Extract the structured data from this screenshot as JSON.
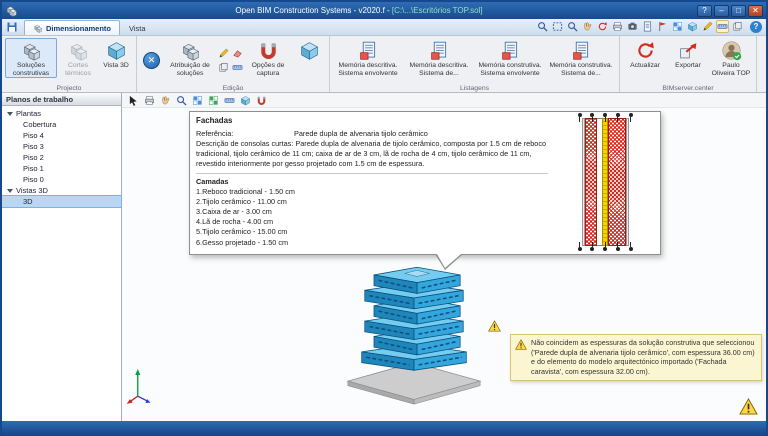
{
  "window": {
    "title_main": "Open BIM Construction Systems - v2020.f -",
    "title_path": "[C:\\...\\Escritórios TOP.sol]"
  },
  "glyphs": {
    "min": "–",
    "max": "□",
    "close": "✕",
    "help": "?"
  },
  "tabs": {
    "dimensionamento": "Dimensionamento",
    "vista": "Vista"
  },
  "ribbon": {
    "projecto": {
      "label": "Projecto",
      "solucoes": "Soluções construtivas",
      "cortes": "Cortes térmicos",
      "vista3d": "Vista 3D"
    },
    "edicao": {
      "label": "Edição",
      "atribuicao": "Atribuição de soluções",
      "opcoes": "Opções de captura"
    },
    "listagens": {
      "label": "Listagens",
      "b1": "Memória descritiva. Sistema envolvente",
      "b2": "Memória descritiva. Sistema de...",
      "b3": "Memória construtiva. Sistema envolvente",
      "b4": "Memória construtiva. Sistema de..."
    },
    "bimserver": {
      "label": "BIMserver.center",
      "actualizar": "Actualizar",
      "exportar": "Exportar",
      "user": "Paulo Oliveira TOP"
    }
  },
  "sidebar": {
    "title": "Planos de trabalho",
    "plantas_label": "Plantas",
    "plantas": [
      "Cobertura",
      "Piso 4",
      "Piso 3",
      "Piso 2",
      "Piso 1",
      "Piso 0"
    ],
    "vistas_label": "Vistas 3D",
    "vista3d_item": "3D"
  },
  "popup": {
    "title": "Fachadas",
    "ref_label": "Referência:",
    "ref_value": "Parede dupla de alvenaria tijolo cerâmico",
    "desc_label": "Descrição de consolas curtas:",
    "desc_value": "Parede dupla de alvenaria de tijolo cerâmico, composta por 1.5 cm de reboco tradicional, tijolo cerâmico de 11 cm; caixa de ar de 3 cm, lã de rocha de 4 cm, tijolo cerâmico de 11 cm, revestido interiormente por gesso projetado com 1.5 cm de espessura.",
    "camadas_label": "Camadas",
    "camadas": [
      "1.Reboco tradicional - 1.50 cm",
      "2.Tijolo cerâmico - 11.00 cm",
      "3.Caixa de ar - 3.00 cm",
      "4.Lã de rocha - 4.00 cm",
      "5.Tijolo cerâmico - 15.00 cm",
      "6.Gesso projetado - 1.50 cm"
    ]
  },
  "warning": {
    "text": "Não coincidem as espessuras da solução construtiva que seleccionou ('Parede dupla de alvenaria tijolo cerâmico', com espessura 36.00 cm) e do elemento do modelo arquitectónico importado ('Fachada caravista', com espessura 32.00 cm)."
  },
  "colors": {
    "titlebar": "#174a8c",
    "building_face": "#33a7dd",
    "selection": "#b9d7f2",
    "warning_bg": "#fcf5d2",
    "brick_red": "#cd2319",
    "insulation_yellow": "#f2d400"
  },
  "icon_names": {
    "quickbar": [
      "search-icon",
      "zoom-window-icon",
      "zoom-extents-icon",
      "pan-icon",
      "previous-zoom-icon",
      "redraw-icon",
      "print-icon",
      "capture-icon",
      "doc-icon",
      "flag-icon",
      "layers-icon",
      "cube-icon",
      "edit-icon",
      "measure-icon"
    ],
    "canvas_toolbar": [
      "select-icon",
      "print-icon",
      "pan-icon",
      "zoom-window-icon",
      "grid-blue-icon",
      "grid-green-icon",
      "measure-icon",
      "cube-icon",
      "snap-icon"
    ]
  }
}
